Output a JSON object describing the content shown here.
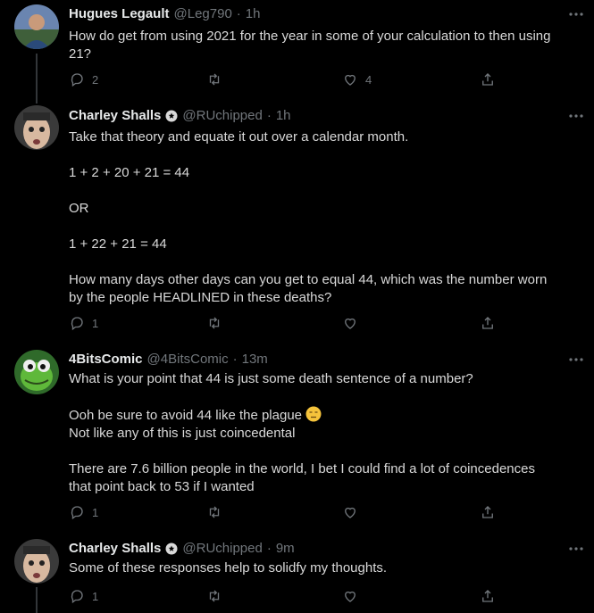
{
  "tweets": [
    {
      "name": "Hugues Legault",
      "handle": "@Leg790",
      "time": "1h",
      "lines": [
        "How do get from using 2021 for the year in some of your calculation to then using",
        "21?"
      ],
      "replies": "2",
      "retweets": "",
      "likes": "4"
    },
    {
      "name": "Charley Shalls",
      "handle": "@RUchipped",
      "time": "1h",
      "lines": [
        "Take that theory and equate it out over a calendar month.",
        "",
        "1 + 2 + 20 + 21 = 44",
        "",
        "OR",
        "",
        "1 + 22 + 21 = 44",
        "",
        "How many days other days can you get to equal 44, which was the number worn",
        "by the people HEADLINED in these deaths?"
      ],
      "replies": "1",
      "retweets": "",
      "likes": ""
    },
    {
      "name": "4BitsComic",
      "handle": "@4BitsComic",
      "time": "13m",
      "lines": [
        "What is your point that 44 is just some death sentence of a number?",
        "",
        "Ooh be sure to avoid 44 like the plague",
        "Not like any of this is just coincedental",
        "",
        "There are 7.6 billion people in the world, I bet I could find a lot of coincedences",
        "that point back to 53 if I wanted"
      ],
      "replies": "1",
      "retweets": "",
      "likes": ""
    },
    {
      "name": "Charley Shalls",
      "handle": "@RUchipped",
      "time": "9m",
      "lines": [
        "Some of these responses help to solidfy my thoughts."
      ],
      "replies": "1",
      "retweets": "",
      "likes": ""
    }
  ],
  "separator": "·",
  "icons": {
    "reply": "reply-icon",
    "retweet": "retweet-icon",
    "like": "heart-icon",
    "share": "share-icon",
    "more": "more-icon",
    "verified": "verified-badge-icon",
    "emoji": "unamused-face-emoji"
  },
  "colors": {
    "background": "#000000",
    "text": "#d9d9d9",
    "muted": "#71767b",
    "thread_line": "#333639"
  }
}
